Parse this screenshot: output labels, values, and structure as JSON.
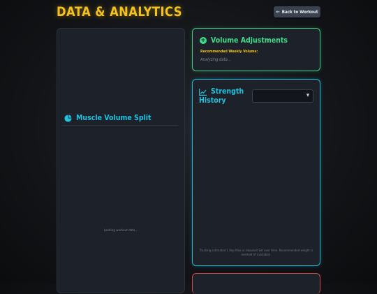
{
  "header": {
    "title": "DATA & ANALYTICS",
    "back_button_label": "Back to Workout"
  },
  "muscle_split": {
    "title": "Muscle Volume Split",
    "loading_text": "Loading workout data..."
  },
  "volume_adjustments": {
    "title": "Volume Adjustments",
    "recommended_label": "Recommended Weekly Volume:",
    "status_text": "Analyzing data..."
  },
  "strength_history": {
    "title_line1": "Strength",
    "title_line2": "History",
    "select_value": "",
    "footnote": "Tracking estimated 1 Rep Max or Heaviest Set over time. Recommended weight is overlaid (if available)."
  },
  "colors": {
    "accent_yellow": "#f5c21b",
    "accent_green": "#3fdc8a",
    "accent_cyan": "#22c2e0",
    "accent_red": "#d84a4a"
  },
  "icons": {
    "back": "arrow-left-icon",
    "muscle": "pie-chart-icon",
    "volume": "plus-circle-icon",
    "strength": "line-chart-icon",
    "select": "chevron-down-icon"
  }
}
